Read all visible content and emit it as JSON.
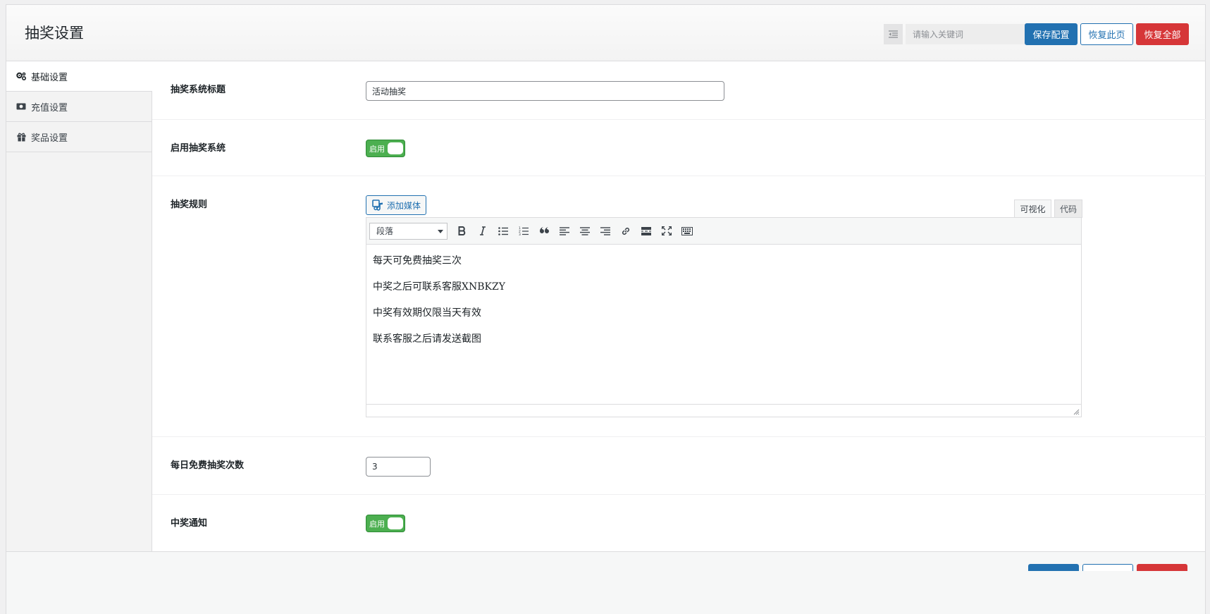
{
  "header": {
    "title": "抽奖设置",
    "search_placeholder": "请输入关键词",
    "save_label": "保存配置",
    "restore_page_label": "恢复此页",
    "restore_all_label": "恢复全部"
  },
  "sidebar": {
    "items": [
      {
        "label": "基础设置",
        "icon": "gears-icon",
        "active": true
      },
      {
        "label": "充值设置",
        "icon": "money-icon",
        "active": false
      },
      {
        "label": "奖品设置",
        "icon": "gift-icon",
        "active": false
      }
    ]
  },
  "fields": {
    "system_title": {
      "label": "抽奖系统标题",
      "value": "活动抽奖"
    },
    "enable_system": {
      "label": "启用抽奖系统",
      "switch_text": "启用",
      "on": true
    },
    "rules": {
      "label": "抽奖规则",
      "add_media_label": "添加媒体",
      "tab_visual": "可视化",
      "tab_code": "代码",
      "format_select": "段落",
      "content": [
        "每天可免费抽奖三次",
        "中奖之后可联系客服XNBKZY",
        "中奖有效期仅限当天有效",
        "联系客服之后请发送截图"
      ]
    },
    "daily_free": {
      "label": "每日免费抽奖次数",
      "value": "3"
    },
    "win_notice": {
      "label": "中奖通知",
      "switch_text": "启用",
      "on": true
    }
  },
  "colors": {
    "primary": "#2271b1",
    "danger": "#d63638",
    "switch_on": "#4caf50"
  }
}
